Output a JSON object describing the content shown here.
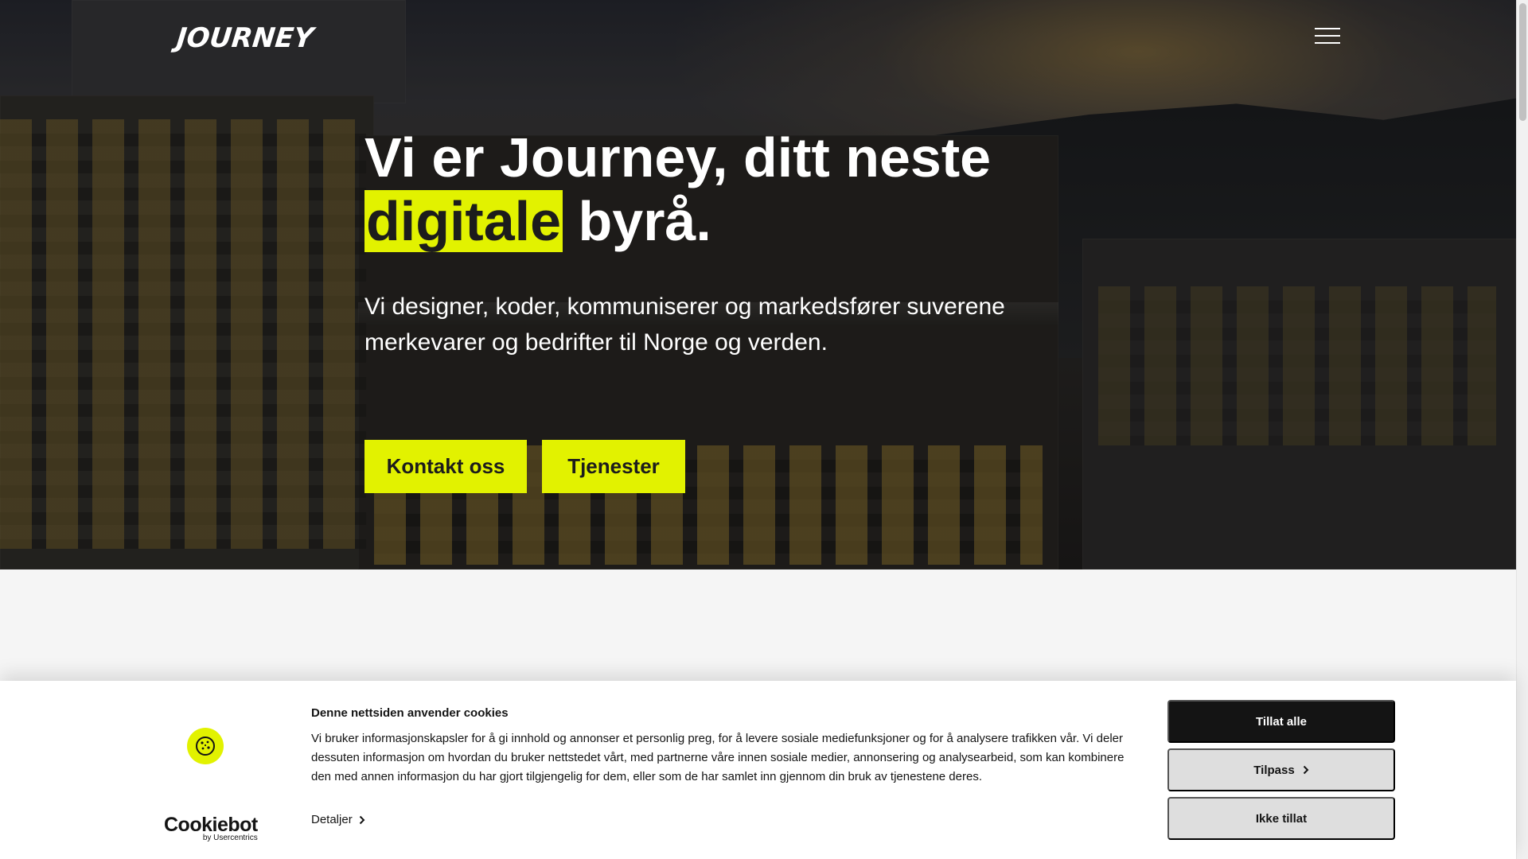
{
  "header": {
    "logo_text": "JOURNEY",
    "menu_icon": "hamburger-menu-icon"
  },
  "hero": {
    "headline_prefix": "Vi er Journey, ditt neste",
    "headline_highlight": "digitale",
    "headline_suffix": "byrå.",
    "subtext": "Vi designer, koder, kommuniserer og markedsfører suverene merkevarer og bedrifter til Norge og verden.",
    "buttons": {
      "contact_label": "Kontakt oss",
      "services_label": "Tjenester"
    },
    "accent_color": "#e2f200"
  },
  "cookie_banner": {
    "title": "Denne nettsiden anvender cookies",
    "body": "Vi bruker informasjonskapsler for å gi innhold og annonser et personlig preg, for å levere sosiale mediefunksjoner og for å analysere trafikken vår. Vi deler dessuten informasjon om hvordan du bruker nettstedet vårt, med partnerne våre innen sosiale medier, annonsering og analysearbeid, som kan kombinere den med annen informasjon du har gjort tilgjengelig for dem, eller som de har samlet inn gjennom din bruk av tjenestene deres.",
    "details_label": "Detaljer",
    "brand": {
      "name": "Cookiebot",
      "by_line": "by Usercentrics"
    },
    "buttons": {
      "allow_all": "Tillat alle",
      "customize": "Tilpass",
      "deny": "Ikke tillat"
    },
    "icon": "cookie-icon"
  }
}
